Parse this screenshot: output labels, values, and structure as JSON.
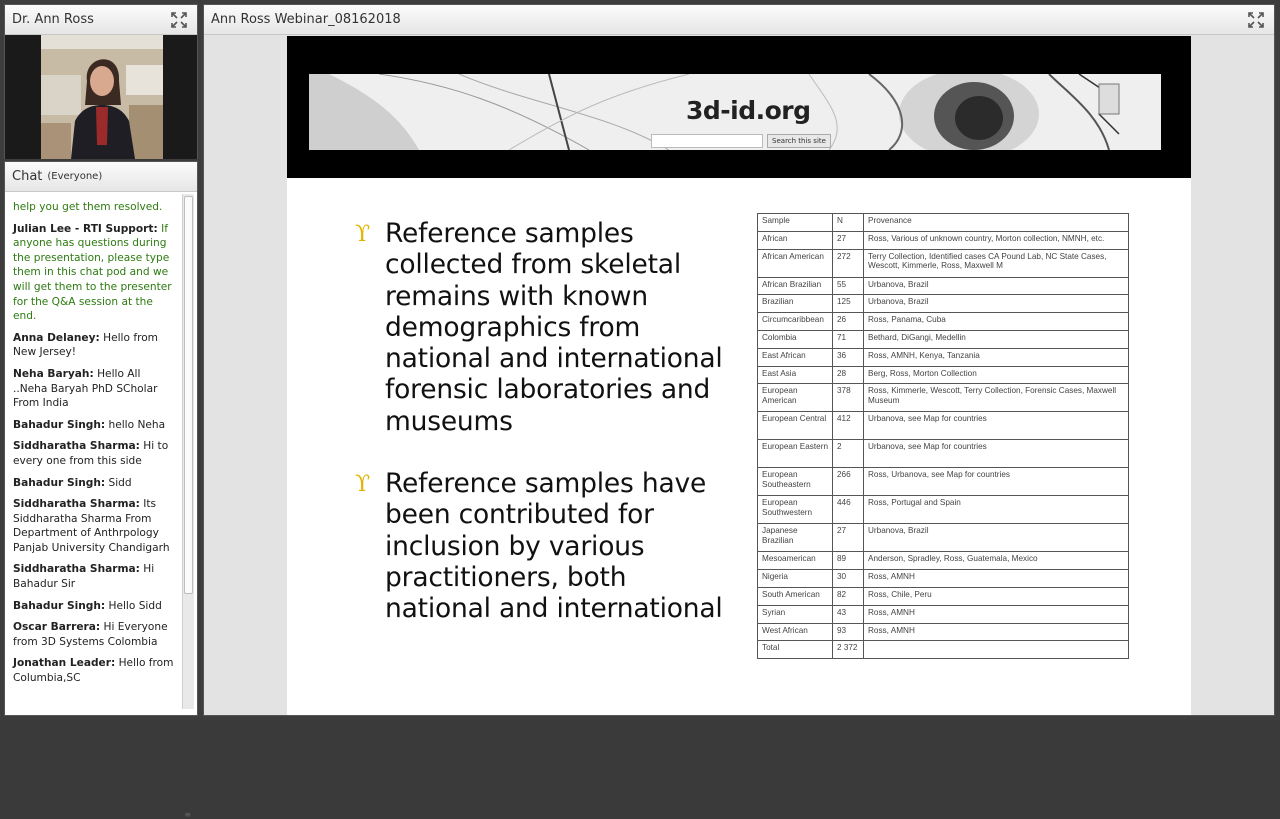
{
  "camera_pod": {
    "title": "Dr. Ann Ross"
  },
  "chat_pod": {
    "title": "Chat",
    "scope": "(Everyone)",
    "messages": [
      {
        "sender": "",
        "text": "help you get them resolved."
      },
      {
        "sender": "Julian Lee - RTI Support:",
        "text": " If anyone has questions during the presentation, please type them in this chat pod and we will get them to the presenter for the Q&A session at the end."
      },
      {
        "sender": "Anna Delaney:",
        "text": " Hello from New Jersey!"
      },
      {
        "sender": "Neha Baryah:",
        "text": " Hello All ..Neha Baryah PhD SCholar From India"
      },
      {
        "sender": "Bahadur Singh:",
        "text": " hello Neha"
      },
      {
        "sender": "Siddharatha  Sharma:",
        "text": " Hi to every one from this side"
      },
      {
        "sender": "Bahadur Singh:",
        "text": " Sidd"
      },
      {
        "sender": "Siddharatha  Sharma:",
        "text": " Its Siddharatha Sharma From Department of Anthrpology Panjab University Chandigarh"
      },
      {
        "sender": "Siddharatha  Sharma:",
        "text": " Hi Bahadur Sir"
      },
      {
        "sender": "Bahadur Singh:",
        "text": " Hello Sidd"
      },
      {
        "sender": "Oscar Barrera:",
        "text": " Hi Everyone from 3D Systems Colombia"
      },
      {
        "sender": "Jonathan Leader:",
        "text": " Hello from Columbia,SC"
      }
    ]
  },
  "share_pod": {
    "title": "Ann Ross Webinar_08162018"
  },
  "slide": {
    "banner": {
      "site_name": "3d-id.org",
      "search_button": "Search this site"
    },
    "bullets": [
      "Reference samples collected from skeletal remains with known demographics from national and international forensic laboratories and museums",
      "Reference samples have been contributed for inclusion by various practitioners, both national and international"
    ],
    "bullet_marker": "ϒ",
    "table": {
      "headers": [
        "Sample",
        "N",
        "Provenance"
      ],
      "rows": [
        [
          "African",
          "27",
          "Ross, Various of unknown country, Morton collection, NMNH, etc."
        ],
        [
          "African American",
          "272",
          "Terry Collection, Identified cases CA Pound Lab, NC State Cases, Wescott, Kimmerle, Ross, Maxwell M"
        ],
        [
          "African Brazilian",
          "55",
          "Urbanova, Brazil"
        ],
        [
          "Brazilian",
          "125",
          "Urbanova, Brazil"
        ],
        [
          "Circumcaribbean",
          "26",
          "Ross, Panama, Cuba"
        ],
        [
          "Colombia",
          "71",
          "Bethard, DiGangi, Medellin"
        ],
        [
          "East African",
          "36",
          "Ross, AMNH, Kenya, Tanzania"
        ],
        [
          "East Asia",
          "28",
          "Berg, Ross, Morton Collection"
        ],
        [
          "European American",
          "378",
          "Ross, Kimmerle, Wescott, Terry Collection, Forensic Cases, Maxwell Museum"
        ],
        [
          "European Central",
          "412",
          "Urbanova, see Map for countries"
        ],
        [
          "European Eastern",
          "2",
          "Urbanova, see Map for countries"
        ],
        [
          "European Southeastern",
          "266",
          "Ross, Urbanova, see Map for countries"
        ],
        [
          "European Southwestern",
          "446",
          "Ross, Portugal and Spain"
        ],
        [
          "Japanese Brazilian",
          "27",
          "Urbanova, Brazil"
        ],
        [
          "Mesoamerican",
          "89",
          "Anderson, Spradley, Ross, Guatemala, Mexico"
        ],
        [
          "Nigeria",
          "30",
          "Ross, AMNH"
        ],
        [
          "South American",
          "82",
          "Ross, Chile, Peru"
        ],
        [
          "Syrian",
          "43",
          "Ross, AMNH"
        ],
        [
          "West African",
          "93",
          "Ross, AMNH"
        ],
        [
          "Total",
          "2 372",
          ""
        ]
      ]
    }
  }
}
